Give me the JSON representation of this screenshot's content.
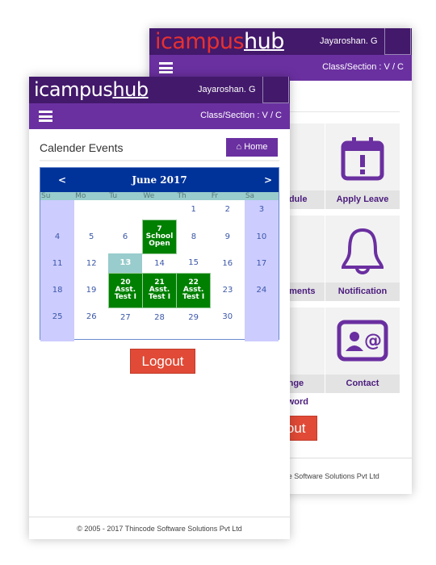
{
  "back": {
    "logo": {
      "prefix": "icampus",
      "suffix": "hub"
    },
    "user": "Jayaroshan. G",
    "class_section": "Class/Section : V / C",
    "tiles": [
      {
        "label": "Schedule",
        "icon": "calendar-clock-icon"
      },
      {
        "label": "Apply Leave",
        "icon": "calendar-alert-icon"
      },
      {
        "label": "Assignments",
        "icon": "user-icon"
      },
      {
        "label": "Notification",
        "icon": "bell-icon"
      },
      {
        "label": "Change Password",
        "icon": "refresh-icon"
      },
      {
        "label": "Contact",
        "icon": "contact-card-icon"
      }
    ],
    "logout": "Logout",
    "footer": "© 2005 - 2017 Thincode Software Solutions Pvt  Ltd"
  },
  "front": {
    "logo": {
      "prefix": "icampus",
      "suffix": "hub"
    },
    "user": "Jayaroshan. G",
    "class_section": "Class/Section : V / C",
    "title": "Calender Events",
    "home": "Home",
    "calendar": {
      "month": "June 2017",
      "prev": "<",
      "next": ">",
      "weekdays": [
        "Su",
        "Mo",
        "Tu",
        "We",
        "Th",
        "Fr",
        "Sa"
      ],
      "weeks": [
        [
          {
            "d": ""
          },
          {
            "d": ""
          },
          {
            "d": ""
          },
          {
            "d": ""
          },
          {
            "d": "1"
          },
          {
            "d": "2"
          },
          {
            "d": "3"
          }
        ],
        [
          {
            "d": "4"
          },
          {
            "d": "5"
          },
          {
            "d": "6"
          },
          {
            "d": "7",
            "event": "School Open"
          },
          {
            "d": "8"
          },
          {
            "d": "9"
          },
          {
            "d": "10"
          }
        ],
        [
          {
            "d": "11"
          },
          {
            "d": "12"
          },
          {
            "d": "13",
            "today": true
          },
          {
            "d": "14"
          },
          {
            "d": "15"
          },
          {
            "d": "16"
          },
          {
            "d": "17"
          }
        ],
        [
          {
            "d": "18"
          },
          {
            "d": "19"
          },
          {
            "d": "20",
            "event": "Asst. Test I"
          },
          {
            "d": "21",
            "event": "Asst. Test I"
          },
          {
            "d": "22",
            "event": "Asst. Test I"
          },
          {
            "d": "23"
          },
          {
            "d": "24"
          }
        ],
        [
          {
            "d": "25"
          },
          {
            "d": "26"
          },
          {
            "d": "27"
          },
          {
            "d": "28"
          },
          {
            "d": "29"
          },
          {
            "d": "30"
          },
          {
            "d": ""
          }
        ]
      ],
      "colors": {
        "header": "#003399",
        "weekday": "#99cccc",
        "weekend": "#ccccff",
        "event": "#008000"
      }
    },
    "logout": "Logout",
    "footer": "© 2005 - 2017 Thincode Software Solutions Pvt Ltd"
  },
  "colors": {
    "header": "#43196b",
    "nav": "#6a30a0",
    "logout": "#e04a36",
    "logo_back": "#e8312f"
  }
}
